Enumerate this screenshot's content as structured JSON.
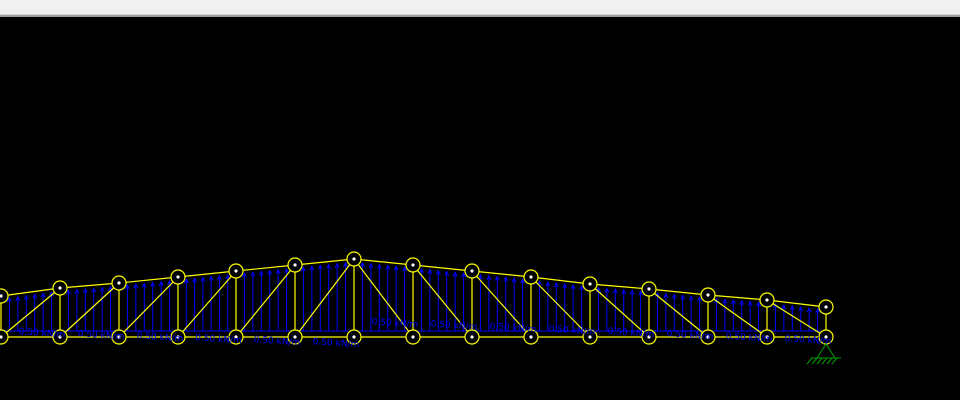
{
  "window": {
    "toolbar_color": "#f0f0f0"
  },
  "colors": {
    "background": "#000000",
    "member": "#ffff00",
    "node_ring": "#ffff00",
    "node_dot": "#ffffff",
    "load": "#0000ff",
    "support": "#00a000"
  },
  "icons": {
    "node": "node-circle-icon",
    "support": "pinned-support-icon",
    "load": "distributed-load-arrows-icon"
  },
  "truss": {
    "load_labels": [
      "0.50 kN/m",
      "0.50 kN/m",
      "0.50 kN/m",
      "0.50 kN/m",
      "0.50 kN/m",
      "0.50 kN/m",
      "0.50 kN/m",
      "0.50 kN/m",
      "0.50 kN/m",
      "0.50 kN/m",
      "0.50 kN/m",
      "0.50 kN/m",
      "0.50 kN/m",
      "0.50 kN/m"
    ]
  }
}
